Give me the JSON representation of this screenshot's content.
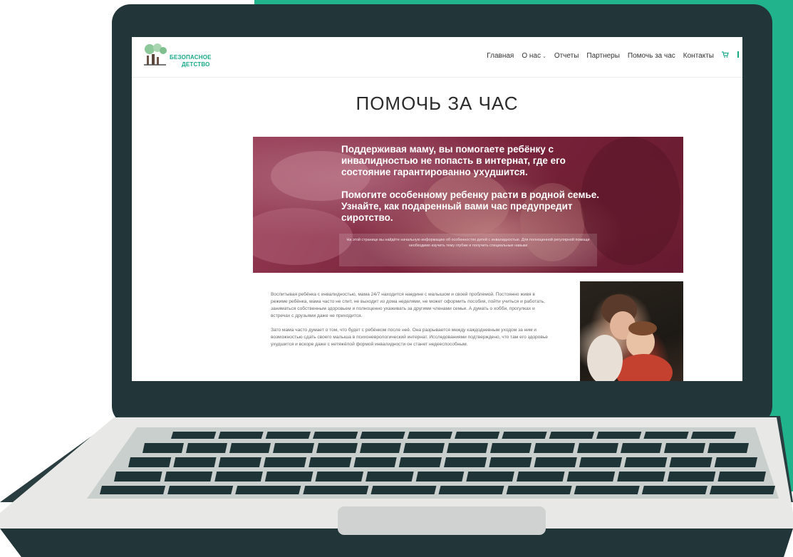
{
  "site": {
    "logo": {
      "line1": "БЕЗОПАСНОЕ",
      "line2": "ДЕТСТВО"
    },
    "nav": {
      "items": [
        "Главная",
        "О нас",
        "Отчеты",
        "Партнеры",
        "Помочь за час",
        "Контакты"
      ],
      "dropdown_item": "О нас"
    },
    "page_title": "ПОМОЧЬ ЗА ЧАС",
    "hero": {
      "paragraph1": "Поддерживая маму, вы помогаете ребёнку с инвалидностью не попасть в интернат, где его состояние гарантированно ухудшится.",
      "paragraph2": "Помогите особенному ребенку расти в родной семье. Узнайте, как подаренный вами час предупредит сиротство.",
      "note": "На этой странице вы найдёте начальную информацию об особенностях детей с инвалидностью. Для полноценной регулярной помощи необходимо изучить тему глубже и получить специальные навыки"
    },
    "body": {
      "paragraph1": "Воспитывая ребёнка с инвалидностью, мама 24/7 находится наедине с малышом и своей проблемой. Постоянно живя в режиме ребёнка, мама часто не спит, не выходит из дома неделями, не может оформить пособия, пойти учиться и работать, заниматься собственным здоровьем и полноценно ухаживать за другими членами семьи. А думать о хобби, прогулках и встречах с друзьями даже не приходится.",
      "paragraph2": "Зато мама часто думает о том, что будет с ребёнком после неё. Она разрывается между каждодневным уходом за ним и возможностью сдать своего малыша в психоневрологический интернат. Исследованиями подтверждено, что там его здоровье ухудшится и вскоре даже с нетяжёлой формой инвалидности он станет недееспособным."
    }
  },
  "colors": {
    "teal_background": "#20b38c",
    "laptop_bezel": "#22363a",
    "laptop_base": "#e8e8e6",
    "keys": "#1f3436",
    "brand_green": "#18a98a"
  },
  "icons": [
    "cart-icon",
    "menu-icon"
  ]
}
